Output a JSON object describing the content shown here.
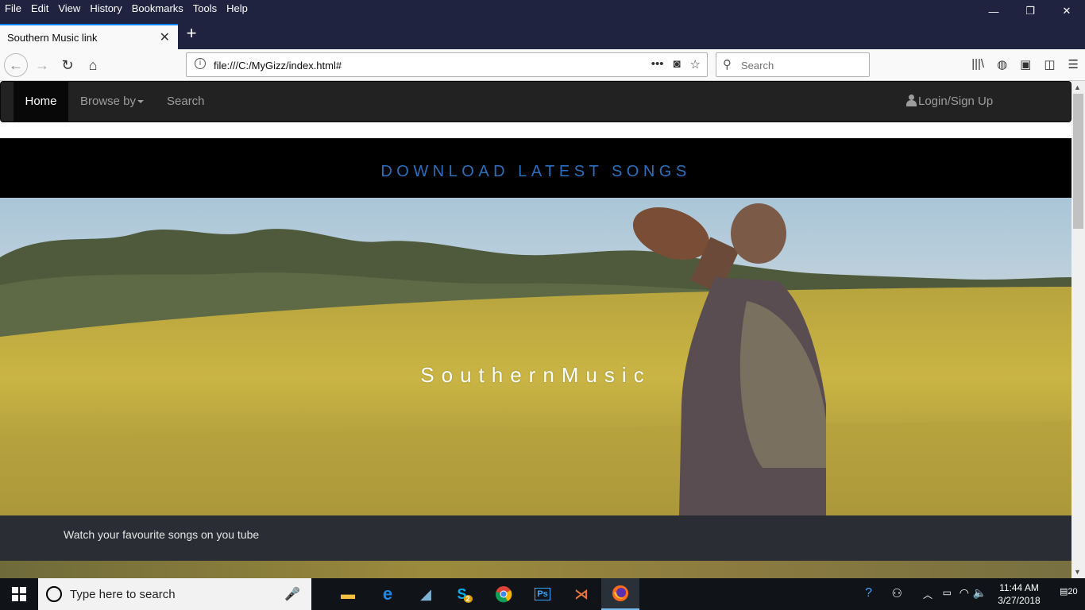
{
  "browser": {
    "menu": [
      "File",
      "Edit",
      "View",
      "History",
      "Bookmarks",
      "Tools",
      "Help"
    ],
    "tab_title": "Southern Music link",
    "url": "file:///C:/MyGizz/index.html#",
    "search_placeholder": "Search",
    "window_controls": {
      "minimize": "—",
      "restore": "❐",
      "close": "✕"
    }
  },
  "site": {
    "nav": {
      "home": "Home",
      "browse": "Browse by",
      "search": "Search",
      "login": "Login/Sign Up"
    },
    "banner_title": "DOWNLOAD LATEST SONGS",
    "hero_title": "SouthernMusic",
    "footer_text": "Watch your favourite songs on you tube"
  },
  "taskbar": {
    "search_placeholder": "Type here to search",
    "time": "11:44 AM",
    "date": "3/27/2018",
    "notification_count": "20",
    "skype_badge": "2",
    "apps": [
      "file-explorer",
      "edge",
      "app-blue",
      "skype",
      "chrome",
      "photoshop",
      "visual-studio",
      "firefox"
    ]
  },
  "colors": {
    "browser_dark": "#202340",
    "site_nav": "#222222",
    "banner_text": "#2a6fbd",
    "footer_band": "#2a2d33",
    "taskbar": "#101418"
  }
}
